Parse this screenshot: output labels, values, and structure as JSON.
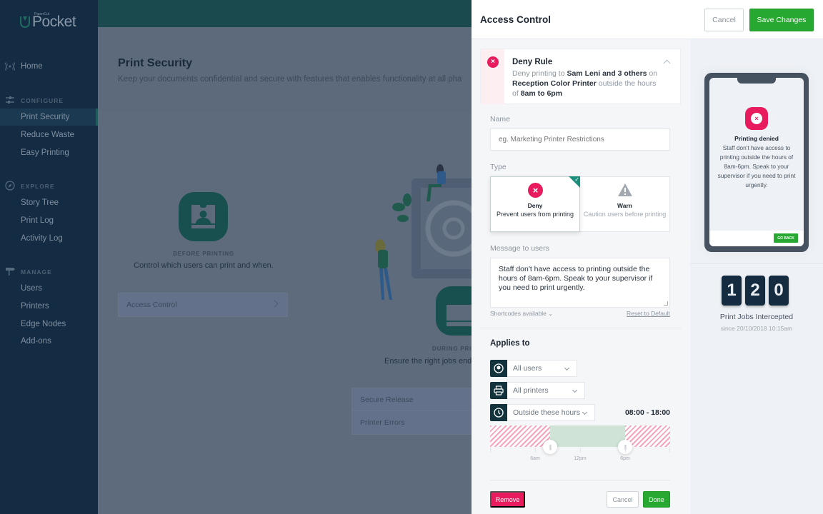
{
  "sidebar": {
    "brand_small": "PaperCut",
    "brand_name": "Pocket",
    "home": {
      "label": "Home",
      "icon": "broadcast-icon"
    },
    "sections": [
      {
        "title": "CONFIGURE",
        "icon": "sliders-icon",
        "items": [
          {
            "label": "Print Security",
            "active": true
          },
          {
            "label": "Reduce Waste"
          },
          {
            "label": "Easy Printing"
          }
        ]
      },
      {
        "title": "EXPLORE",
        "icon": "compass-icon",
        "items": [
          {
            "label": "Story Tree"
          },
          {
            "label": "Print Log"
          },
          {
            "label": "Activity Log"
          }
        ]
      },
      {
        "title": "MANAGE",
        "icon": "signpost-icon",
        "items": [
          {
            "label": "Users"
          },
          {
            "label": "Printers"
          },
          {
            "label": "Edge Nodes"
          },
          {
            "label": "Add-ons"
          }
        ]
      }
    ]
  },
  "main": {
    "title": "Print Security",
    "subtitle": "Keep your documents confidential and secure with features that enables functionality at all pha",
    "before": {
      "label": "BEFORE PRINTING",
      "desc": "Control which users can print and when.",
      "items": [
        {
          "label": "Access Control"
        }
      ]
    },
    "during": {
      "label": "DURING PRI",
      "desc": "Ensure the right jobs end u",
      "items": [
        {
          "label": "Secure Release"
        },
        {
          "label": "Printer Errors"
        }
      ]
    }
  },
  "drawer": {
    "title": "Access Control",
    "cancel_label": "Cancel",
    "save_label": "Save Changes",
    "rule": {
      "title": "Deny Rule",
      "desc_parts": [
        "Deny printing to ",
        "Sam Leni and 3 others",
        " on ",
        "Reception Color Printer",
        " outside the hours of ",
        "8am to 6pm"
      ]
    },
    "name": {
      "label": "Name",
      "placeholder": "eg. Marketing Printer Restrictions",
      "value": ""
    },
    "type": {
      "label": "Type",
      "options": [
        {
          "title": "Deny",
          "desc": "Prevent users from printing",
          "selected": true
        },
        {
          "title": "Warn",
          "desc": "Caution users before printing",
          "selected": false
        }
      ]
    },
    "message": {
      "label": "Message to users",
      "value": "Staff don't have access to printing outside the hours of 8am-6pm. Speak to your supervisor if you need to print urgently.",
      "shortcodes_label": "Shortcodes available",
      "reset_label": "Reset to Default"
    },
    "applies_to": {
      "title": "Applies to",
      "users": "All users",
      "printers": "All printers",
      "hours_mode": "Outside these hours",
      "time_range": "08:00 - 18:00",
      "range_start_hour": 8,
      "range_end_hour": 18,
      "tick_labels": [
        "6am",
        "12pm",
        "6pm"
      ]
    },
    "remove_label": "Remove",
    "cancel2_label": "Cancel",
    "done_label": "Done"
  },
  "preview": {
    "title": "Printing denied",
    "message": "Staff don't have access to printing outside the hours of 8am-6pm. Speak to your supervisor if you need to print urgently.",
    "go_back": "GO BACK",
    "counter_digits": [
      "1",
      "2",
      "0"
    ],
    "counter_label": "Print Jobs Intercepted",
    "counter_since": "since 20/10/2018 10:15am"
  },
  "colors": {
    "accent_green": "#27a830",
    "deny_red": "#e71b5e",
    "sidebar_bg": "#132c43",
    "teal": "#1a4a4e"
  }
}
